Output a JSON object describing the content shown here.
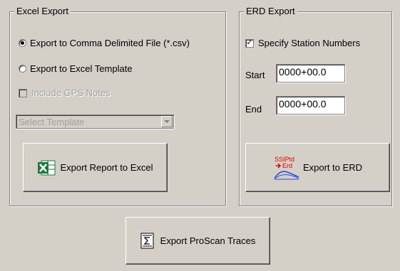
{
  "excel_export": {
    "title": "Excel Export",
    "radio_csv_label": "Export to Comma Delimited File (*.csv)",
    "radio_template_label": "Export to Excel Template",
    "selected_option": "csv",
    "gps_notes_label": "Include GPS Notes",
    "gps_notes_enabled": false,
    "gps_notes_checked": false,
    "template_select": {
      "value": "Select Template",
      "enabled": false
    },
    "export_button_label": "Export Report to Excel",
    "export_button_icon": "excel-icon"
  },
  "erd_export": {
    "title": "ERD Export",
    "specify_station_label": "Specify Station Numbers",
    "specify_station_checked": true,
    "start_label": "Start",
    "start_value": "0000+00.0",
    "end_label": "End",
    "end_value": "0000+00.0",
    "export_button_label": "Export to ERD",
    "export_button_icon": "ssiptd-erd-icon",
    "icon_text_top": "SSIPtd",
    "icon_text_bottom": "Erd",
    "icon_color_text": "#e00000"
  },
  "proscan": {
    "button_label": "Export ProScan Traces",
    "button_icon": "sigma-document-icon"
  }
}
